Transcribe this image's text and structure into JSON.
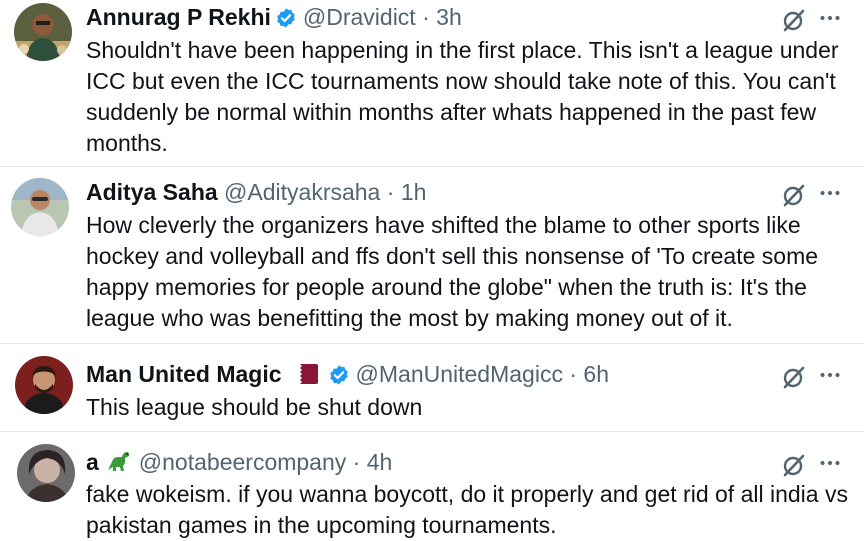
{
  "tweets": [
    {
      "name": "Annurag P Rekhi",
      "verified": true,
      "handle": "@Dravidict",
      "separator": "·",
      "time": "3h",
      "text": "Shouldn't have been happening in the first place. This isn't a league under\nICC but even the ICC tournaments now should take note of this. You can't\nsuddenly be normal within months after whats happened in the past few\nmonths."
    },
    {
      "name": "Aditya Saha",
      "verified": false,
      "handle": "@Adityakrsaha",
      "separator": "·",
      "time": "1h",
      "text": "How cleverly the organizers have shifted the blame to other sports like\nhockey and volleyball and ffs don't sell this nonsense of 'To create some\nhappy memories for people around the globe\" when the truth is: It's the\nleague who was benefitting the most by making money out of it."
    },
    {
      "name": "Man United Magic",
      "verified": true,
      "handle": "@ManUnitedMagicc",
      "separator": "·",
      "time": "6h",
      "text": "This league should be shut down"
    },
    {
      "name": "a",
      "verified": false,
      "handle": "@notabeercompany",
      "separator": "·",
      "time": "4h",
      "text": "fake wokeism. if you wanna boycott, do it properly and get rid of all india vs\npakistan games in the upcoming tournaments."
    }
  ],
  "icons": {
    "verified": "verified-badge-icon",
    "grok": "grok-icon",
    "more": "more-icon",
    "flag": "qatar-flag-icon",
    "dino": "dinosaur-emoji-icon"
  },
  "colors": {
    "text": "#0f1419",
    "secondary": "#536471",
    "verified_blue": "#1d9bf0",
    "divider": "#e6e9eb",
    "flag_maroon": "#8a1538"
  }
}
